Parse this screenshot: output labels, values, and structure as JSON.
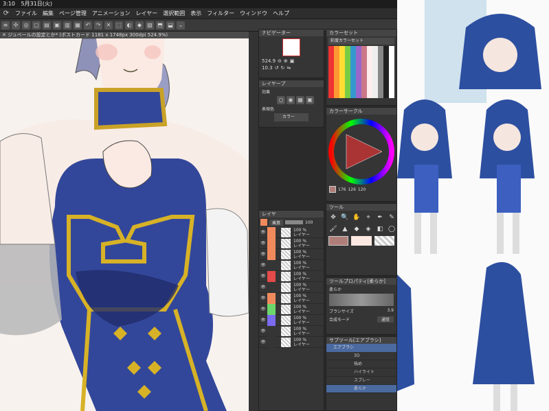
{
  "status": {
    "time": "3:10",
    "date": "5月31日(火)"
  },
  "menu": [
    "ファイル",
    "編集",
    "ページ管理",
    "アニメーション",
    "レイヤー",
    "選択範囲",
    "表示",
    "フィルター",
    "ウィンドウ",
    "ヘルプ"
  ],
  "tab": {
    "title": "ジュベールの設定とか* (ポストカード 1181 x 1748px 300dpi 524.9%)"
  },
  "navigator": {
    "title": "ナビゲーター",
    "zoom": "524.9",
    "angle": "10.3"
  },
  "colorset": {
    "title": "カラーセット",
    "name": "彩度カラーセット"
  },
  "layerprop": {
    "title": "レイヤープ",
    "effect_label": "効果",
    "expression_label": "表現色",
    "expression_value": "カラー"
  },
  "colorcircle": {
    "title": "カラーサークル",
    "rgb": [
      "176",
      "126",
      "120"
    ]
  },
  "layers": {
    "title": "レイヤ",
    "blend": "乗算",
    "opacity": "100",
    "items": [
      {
        "pct": "100 %",
        "name": "レイヤー",
        "color": "#f08a5d"
      },
      {
        "pct": "100 %",
        "name": "レイヤー",
        "color": "#f08a5d"
      },
      {
        "pct": "100 %",
        "name": "レイヤー",
        "color": "#f08a5d"
      },
      {
        "pct": "100 %",
        "name": "レイヤー",
        "color": ""
      },
      {
        "pct": "100 %",
        "name": "レイヤー",
        "color": "#e34a4a"
      },
      {
        "pct": "100 %",
        "name": "レイヤー",
        "color": ""
      },
      {
        "pct": "100 %",
        "name": "レイヤー",
        "color": "#f08a5d"
      },
      {
        "pct": "100 %",
        "name": "レイヤー",
        "color": "#6bd66b"
      },
      {
        "pct": "100 %",
        "name": "レイヤー",
        "color": "#7b6bf0"
      },
      {
        "pct": "100 %",
        "name": "レイヤー",
        "color": ""
      },
      {
        "pct": "100 %",
        "name": "レイヤー",
        "color": ""
      }
    ]
  },
  "tool": {
    "title": "ツール"
  },
  "toolprop": {
    "title": "ツールプロパティ[柔らか]",
    "preset": "柔らか",
    "size_label": "ブラシサイズ",
    "size_value": "3.9",
    "blend_label": "合成モード",
    "blend_value": "通常"
  },
  "subtool": {
    "title": "サブツール[エアブラシ]",
    "group": "エアブラシ",
    "brushes": [
      "",
      "",
      "強め",
      "ハイライト",
      "スプレー",
      "柔らか"
    ],
    "extra": "3D"
  },
  "colors": {
    "main": "#b07e78",
    "sub": "#fbe8e0"
  }
}
